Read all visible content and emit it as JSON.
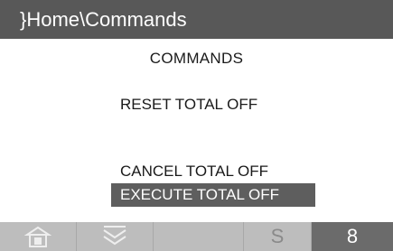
{
  "title_bar": {
    "path": "}Home\\Commands"
  },
  "screen": {
    "heading": "COMMANDS"
  },
  "commands": {
    "reset": "RESET TOTAL OFF",
    "cancel": "CANCEL TOTAL OFF",
    "execute": "EXECUTE TOTAL OFF"
  },
  "toolbar": {
    "home_icon": "home-icon",
    "down_icon": "chevron-down-double-icon",
    "s_key": "S",
    "page_number": "8"
  },
  "colors": {
    "title_bg": "#585858",
    "selection_bg": "#5e5e5e",
    "toolbar_bg": "#bdbdbd"
  }
}
